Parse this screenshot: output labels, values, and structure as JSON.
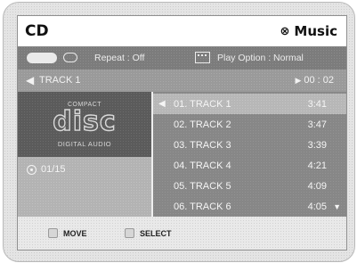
{
  "header": {
    "title": "CD",
    "mode_icon": "circle-x-icon",
    "mode_label": "Music"
  },
  "options": {
    "repeat_label": "Repeat : Off",
    "play_option_label": "Play Option : Normal"
  },
  "now_playing": {
    "track": "TRACK 1",
    "time": "00 : 02"
  },
  "disc": {
    "logo_top": "COMPACT",
    "logo_main": "disc",
    "logo_bottom": "DIGITAL AUDIO",
    "count": "01/15"
  },
  "tracks": [
    {
      "label": "01. TRACK 1",
      "time": "3:41",
      "selected": true
    },
    {
      "label": "02. TRACK 2",
      "time": "3:47"
    },
    {
      "label": "03. TRACK 3",
      "time": "3:39"
    },
    {
      "label": "04. TRACK 4",
      "time": "4:21"
    },
    {
      "label": "05. TRACK 5",
      "time": "4:09"
    },
    {
      "label": "06. TRACK 6",
      "time": "4:05"
    }
  ],
  "footer": {
    "move_label": "MOVE",
    "select_label": "SELECT"
  },
  "colors": {
    "selected_row": "#b7b7b7",
    "list_bg": "#878787",
    "option_bar": "#7c7c7c"
  }
}
